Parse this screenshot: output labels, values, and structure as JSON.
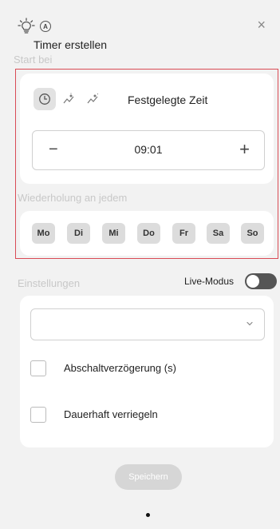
{
  "header": {
    "auto_badge": "A",
    "title": "Timer erstellen",
    "close_glyph": "×"
  },
  "start": {
    "section_label": "Start bei",
    "mode_label": "Festgelegte Zeit",
    "time": {
      "minus": "−",
      "value": "09:01",
      "plus": "+"
    }
  },
  "repeat": {
    "section_label": "Wiederholung an jedem",
    "days": [
      "Mo",
      "Di",
      "Mi",
      "Do",
      "Fr",
      "Sa",
      "So"
    ]
  },
  "settings": {
    "section_label": "Einstellungen",
    "live_mode_label": "Live-Modus",
    "live_mode_on": false,
    "select_value": "",
    "options": [
      {
        "label": "Abschaltverzögerung (s)",
        "checked": false
      },
      {
        "label": "Dauerhaft verriegeln",
        "checked": false
      }
    ]
  },
  "save_label": "Speichern",
  "colors": {
    "highlight_border": "#d94b55",
    "background": "#f2f2f2",
    "card": "#ffffff",
    "day_chip": "#dcdcdc",
    "save_button": "#d6d6d6",
    "toggle_off": "#555555"
  }
}
